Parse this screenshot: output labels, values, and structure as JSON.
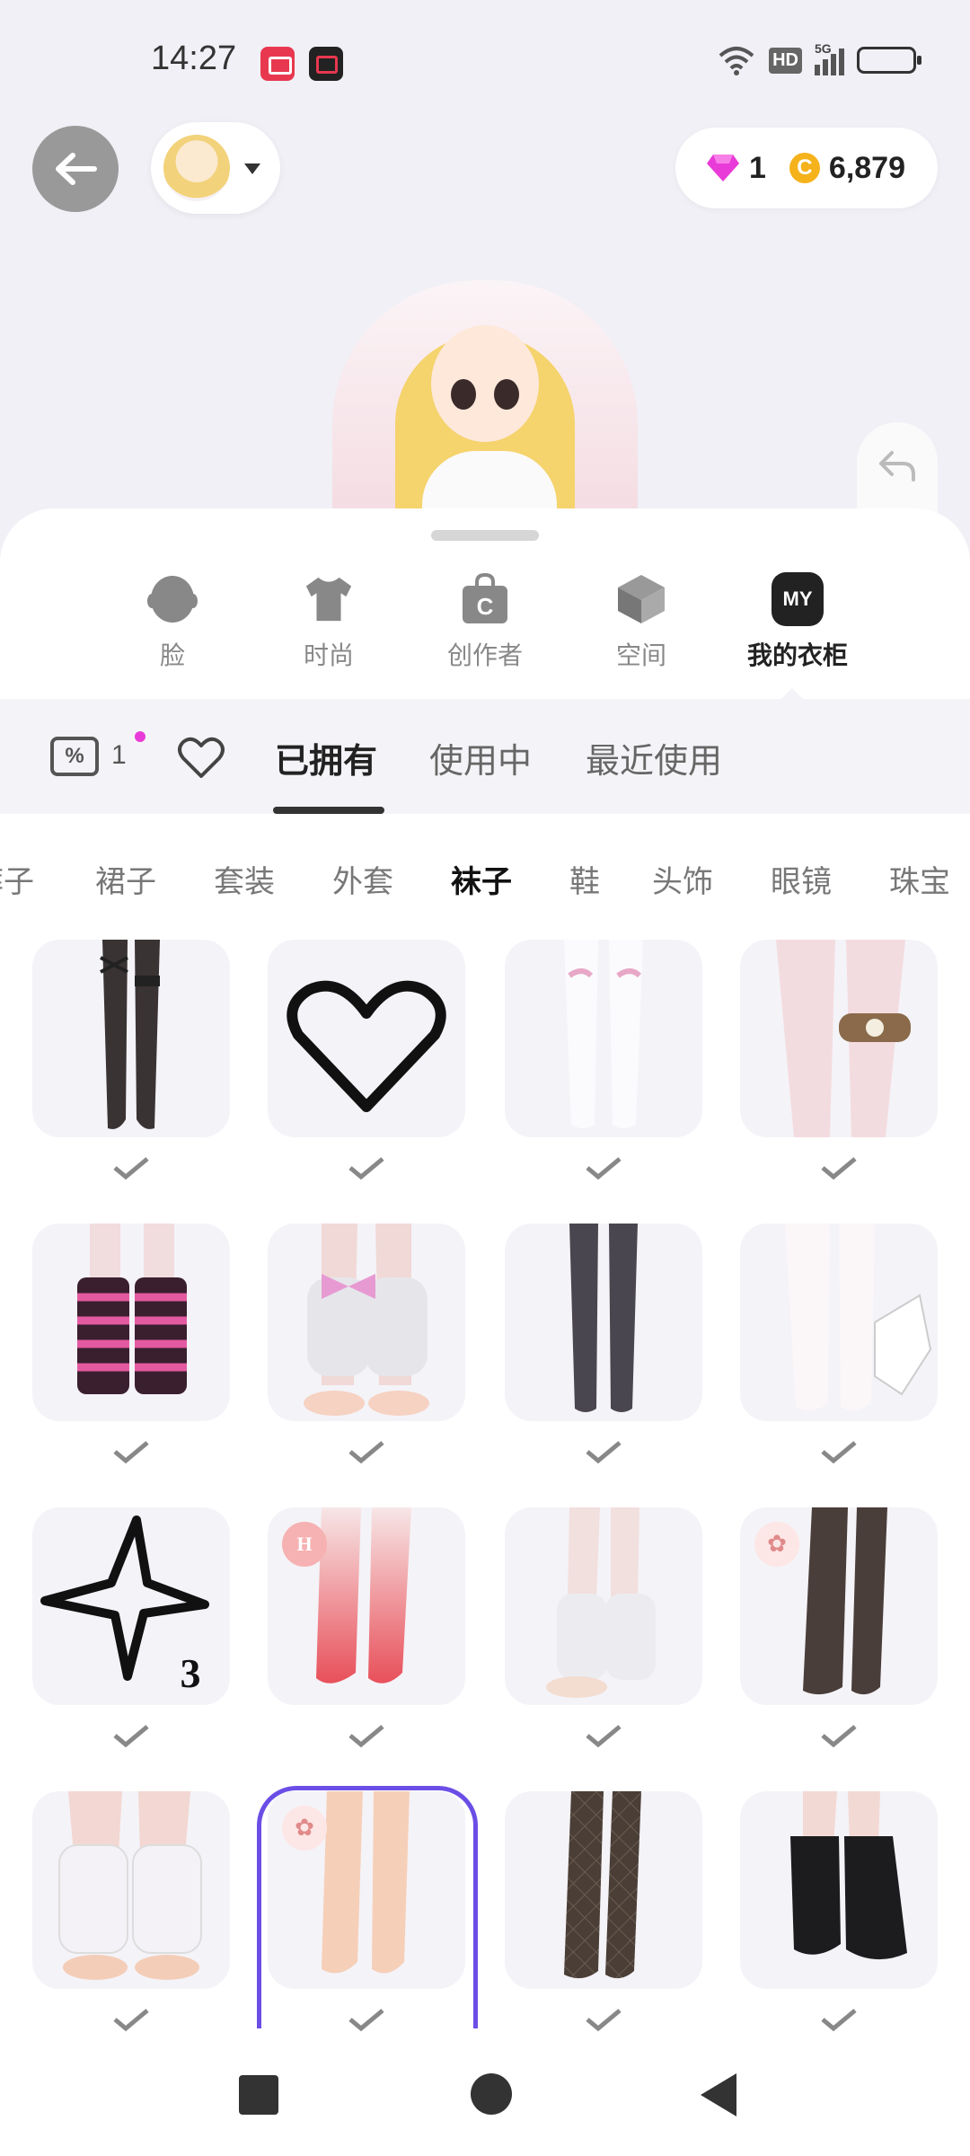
{
  "status": {
    "time": "14:27",
    "network_label": "5G",
    "hd_label": "HD"
  },
  "header": {
    "gems": "1",
    "coins": "6,879",
    "coin_symbol": "C"
  },
  "categories": [
    {
      "label": "脸",
      "icon": "face-icon"
    },
    {
      "label": "时尚",
      "icon": "tshirt-icon"
    },
    {
      "label": "创作者",
      "icon": "creator-bag-icon",
      "glyph": "C"
    },
    {
      "label": "空间",
      "icon": "space-cube-icon"
    },
    {
      "label": "我的衣柜",
      "icon": "my-wardrobe-icon",
      "glyph": "MY",
      "active": true
    }
  ],
  "filter": {
    "coupon_count": "1",
    "tabs": [
      "已拥有",
      "使用中",
      "最近使用"
    ],
    "active_tab": "已拥有"
  },
  "subcategories": [
    "裤子",
    "裙子",
    "套装",
    "外套",
    "袜子",
    "鞋",
    "头饰",
    "眼镜",
    "珠宝"
  ],
  "active_subcategory": "袜子",
  "items": [
    {
      "name": "black-thigh-high-socks",
      "owned": true
    },
    {
      "name": "heart-placeholder",
      "owned": true
    },
    {
      "name": "white-bow-stockings",
      "owned": true
    },
    {
      "name": "fur-heart-garter",
      "owned": true
    },
    {
      "name": "pink-striped-leg-warmers",
      "owned": true
    },
    {
      "name": "pink-bow-leg-warmers",
      "owned": true
    },
    {
      "name": "black-sheer-tights",
      "owned": true
    },
    {
      "name": "white-tights-with-glove",
      "owned": true
    },
    {
      "name": "star-placeholder",
      "owned": true,
      "star_count": "3"
    },
    {
      "name": "pink-gradient-socks",
      "owned": true,
      "badge": "H"
    },
    {
      "name": "white-slouch-socks",
      "owned": true
    },
    {
      "name": "brown-tights",
      "owned": true
    },
    {
      "name": "white-ribbed-leg-warmers",
      "owned": true
    },
    {
      "name": "bare-legs-selected",
      "owned": true,
      "selected": true
    },
    {
      "name": "brown-argyle-tights",
      "owned": true
    },
    {
      "name": "black-ribbed-leg-warmers",
      "owned": true
    }
  ],
  "colors": {
    "selection_accent": "#6b4ee6",
    "notification_dot": "#e93bd8",
    "gem": "#e93bd8",
    "coin": "#f5b21b"
  }
}
